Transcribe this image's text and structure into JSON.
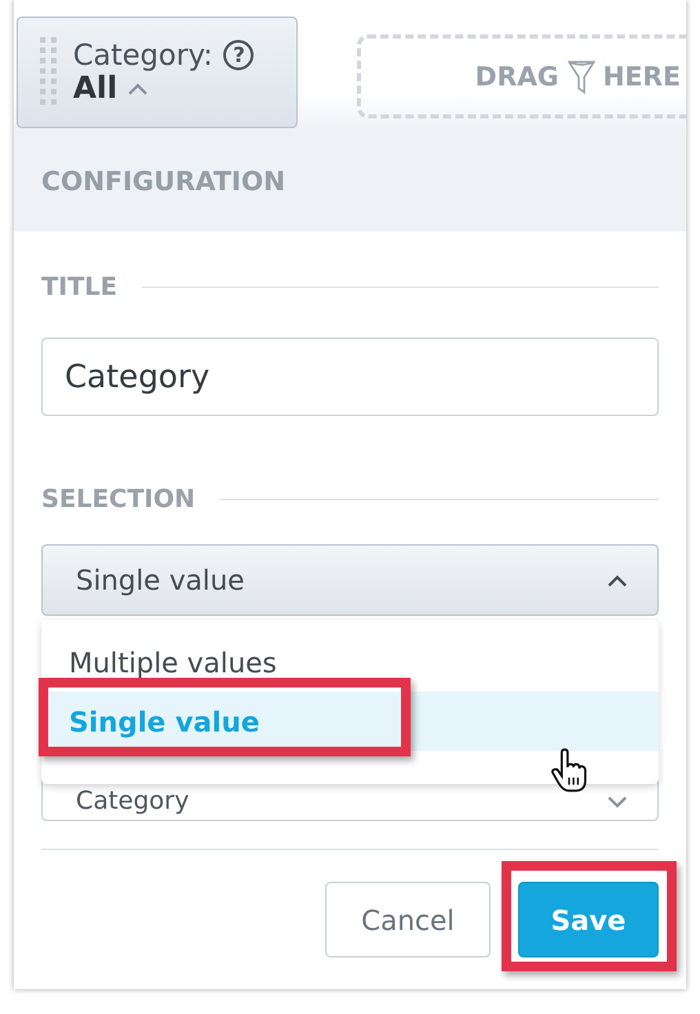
{
  "filter_chip": {
    "label": "Category:",
    "help": "?",
    "value": "All",
    "expanded": true
  },
  "drop_zone": {
    "words": [
      "DRAG",
      "HERE"
    ]
  },
  "panel": {
    "header": "CONFIGURATION",
    "title_section": {
      "label": "TITLE",
      "value": "Category"
    },
    "selection_section": {
      "label": "SELECTION",
      "dropdown": {
        "value": "Single value",
        "expanded": true
      },
      "options": [
        {
          "label": "Multiple values",
          "selected": false,
          "highlighted": false
        },
        {
          "label": "Single value",
          "selected": true,
          "highlighted": true
        }
      ]
    },
    "hidden_field": {
      "value": "Category",
      "expanded": false
    },
    "buttons": [
      {
        "label": "Cancel",
        "kind": "secondary",
        "highlighted": false
      },
      {
        "label": "Save",
        "kind": "primary",
        "highlighted": true
      }
    ]
  }
}
